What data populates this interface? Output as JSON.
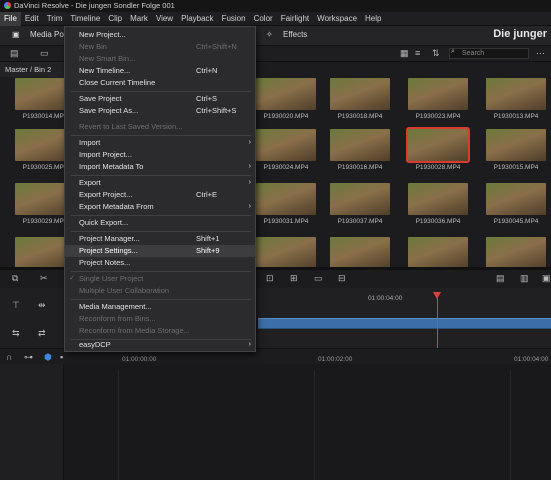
{
  "window": {
    "title": "DaVinci Resolve - Die jungen Sondler Folge 001"
  },
  "menubar": [
    "File",
    "Edit",
    "Trim",
    "Timeline",
    "Clip",
    "Mark",
    "View",
    "Playback",
    "Fusion",
    "Color",
    "Fairlight",
    "Workspace",
    "Help"
  ],
  "toolbar": {
    "media_pool": "Media Poo",
    "effects": "Effects",
    "page_title": "Die junger"
  },
  "search": {
    "placeholder": "Search"
  },
  "bin": {
    "path": "Master / Bin 2"
  },
  "clips": [
    "P1930014.MP4",
    "P1930025.MP4",
    "P1930029.MP4",
    "P1930020.MP4",
    "P1930018.MP4",
    "P1930023.MP4",
    "P1930013.MP4",
    "P1930024.MP4",
    "P1930016.MP4",
    "P1930028.MP4",
    "P1930015.MP4",
    "P1930031.MP4",
    "P1930037.MP4",
    "P1930036.MP4",
    "P1930045.MP4"
  ],
  "timecodes": {
    "ruler_upper": "01:00:04:00",
    "ruler_lower": [
      "01:00:00:00",
      "01:00:02:00",
      "01:00:04:00"
    ]
  },
  "filemenu": {
    "items": [
      {
        "label": "New Project...",
        "shortcut": "",
        "state": "enabled"
      },
      {
        "label": "New Bin",
        "shortcut": "Ctrl+Shift+N",
        "state": "disabled"
      },
      {
        "label": "New Smart Bin...",
        "shortcut": "",
        "state": "disabled"
      },
      {
        "label": "New Timeline...",
        "shortcut": "Ctrl+N",
        "state": "enabled"
      },
      {
        "label": "Close Current Timeline",
        "shortcut": "",
        "state": "enabled"
      },
      {
        "label": "Save Project",
        "shortcut": "Ctrl+S",
        "state": "enabled"
      },
      {
        "label": "Save Project As...",
        "shortcut": "Ctrl+Shift+S",
        "state": "enabled"
      },
      {
        "label": "Revert to Last Saved Version...",
        "shortcut": "",
        "state": "disabled"
      },
      {
        "label": "Import",
        "shortcut": "",
        "state": "enabled",
        "submenu": true
      },
      {
        "label": "Import Project...",
        "shortcut": "",
        "state": "enabled"
      },
      {
        "label": "Import Metadata To",
        "shortcut": "",
        "state": "enabled",
        "submenu": true
      },
      {
        "label": "Export",
        "shortcut": "",
        "state": "enabled",
        "submenu": true
      },
      {
        "label": "Export Project...",
        "shortcut": "Ctrl+E",
        "state": "enabled"
      },
      {
        "label": "Export Metadata From",
        "shortcut": "",
        "state": "enabled",
        "submenu": true
      },
      {
        "label": "Quick Export...",
        "shortcut": "",
        "state": "enabled"
      },
      {
        "label": "Project Manager...",
        "shortcut": "Shift+1",
        "state": "enabled"
      },
      {
        "label": "Project Settings...",
        "shortcut": "Shift+9",
        "state": "highlighted"
      },
      {
        "label": "Project Notes...",
        "shortcut": "",
        "state": "enabled"
      },
      {
        "label": "Single User Project",
        "shortcut": "",
        "state": "disabled",
        "checked": true
      },
      {
        "label": "Multiple User Collaboration",
        "shortcut": "",
        "state": "disabled"
      },
      {
        "label": "Media Management...",
        "shortcut": "",
        "state": "enabled"
      },
      {
        "label": "Reconform from Bins...",
        "shortcut": "",
        "state": "disabled"
      },
      {
        "label": "Reconform from Media Storage...",
        "shortcut": "",
        "state": "disabled"
      },
      {
        "label": "easyDCP",
        "shortcut": "",
        "state": "enabled",
        "submenu": true
      }
    ]
  },
  "icons": {
    "arrow": "chevron-right-icon",
    "check": "checkmark-icon"
  },
  "colors": {
    "accent": "#d93b2f",
    "selection": "#3d3d40",
    "clip_blue": "#3c6fa8"
  }
}
